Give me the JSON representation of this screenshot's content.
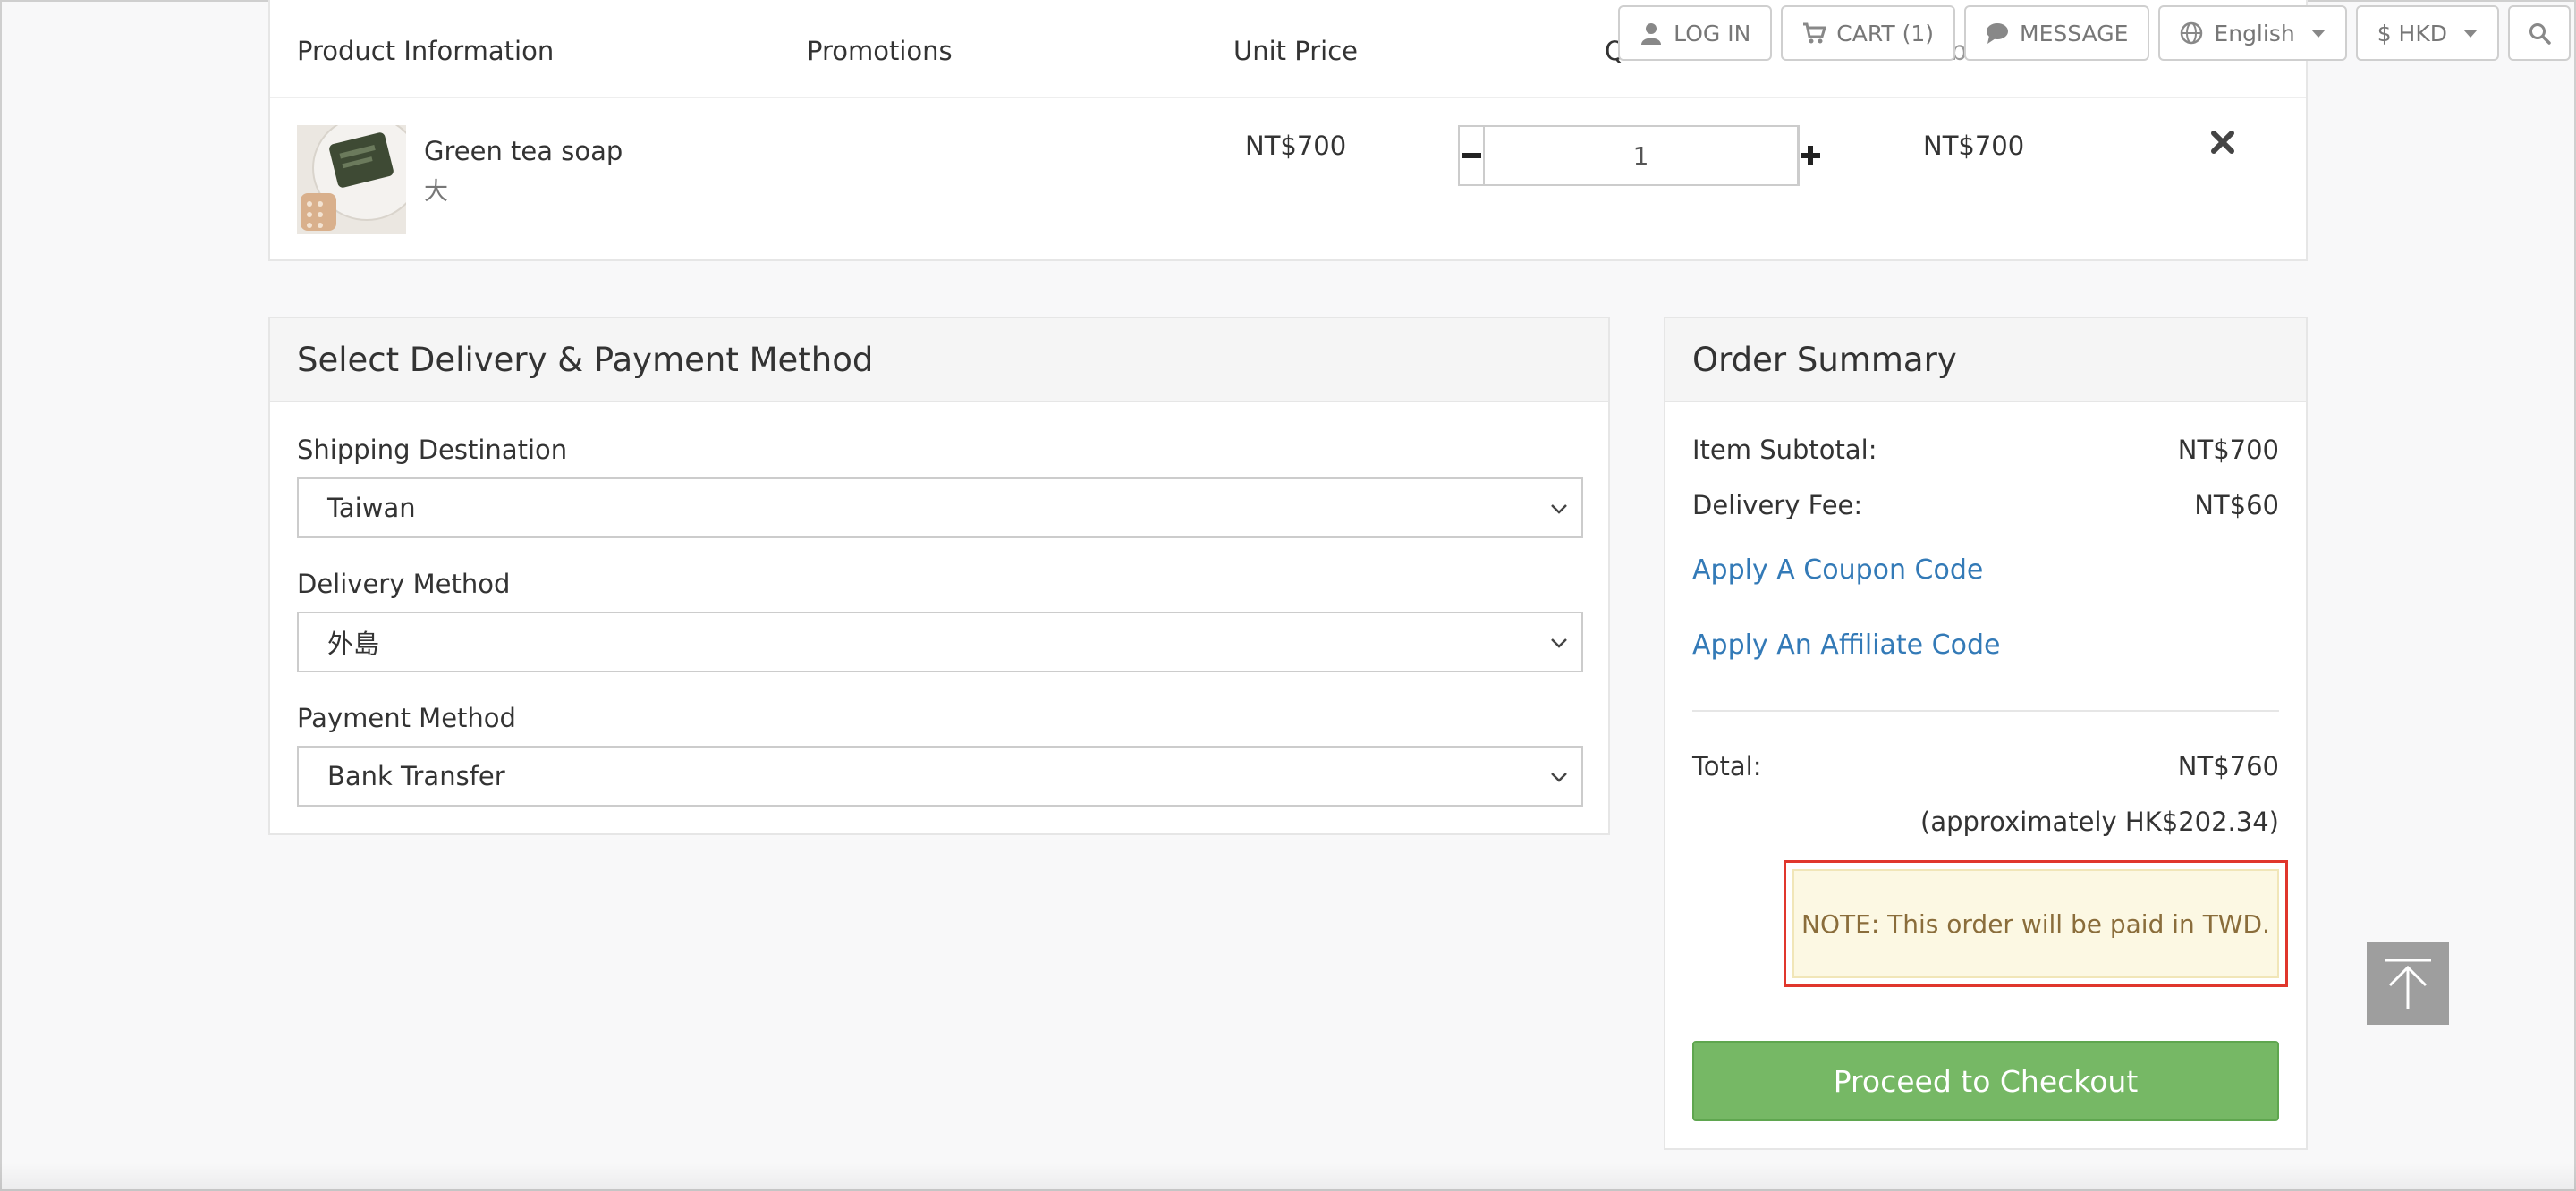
{
  "topbar": {
    "login_label": "LOG IN",
    "cart_label": "CART (1)",
    "message_label": "MESSAGE",
    "language_label": "English",
    "currency_label": "$ HKD"
  },
  "cart": {
    "headers": {
      "product": "Product Information",
      "promotions": "Promotions",
      "unit_price": "Unit Price",
      "qty": "QTY",
      "subtotal": "Subtotal"
    },
    "items": [
      {
        "name": "Green tea soap",
        "variant": "大",
        "unit_price": "NT$700",
        "qty": "1",
        "subtotal": "NT$700"
      }
    ]
  },
  "delivery": {
    "title": "Select Delivery & Payment Method",
    "shipping_label": "Shipping Destination",
    "shipping_value": "Taiwan",
    "method_label": "Delivery Method",
    "method_value": "外島",
    "payment_label": "Payment Method",
    "payment_value": "Bank Transfer"
  },
  "summary": {
    "title": "Order Summary",
    "item_subtotal_label": "Item Subtotal:",
    "item_subtotal_value": "NT$700",
    "delivery_fee_label": "Delivery Fee:",
    "delivery_fee_value": "NT$60",
    "coupon_link": "Apply A Coupon Code",
    "affiliate_link": "Apply An Affiliate Code",
    "total_label": "Total:",
    "total_value": "NT$760",
    "approx_text": "(approximately HK$202.34)",
    "note_text": "NOTE: This order will be paid in TWD.",
    "checkout_label": "Proceed to Checkout"
  },
  "colors": {
    "link": "#337ab7",
    "checkout": "#76b865",
    "note_bg": "#fcf8e3",
    "note_text": "#8a6d3b",
    "highlight": "#e0362c"
  }
}
